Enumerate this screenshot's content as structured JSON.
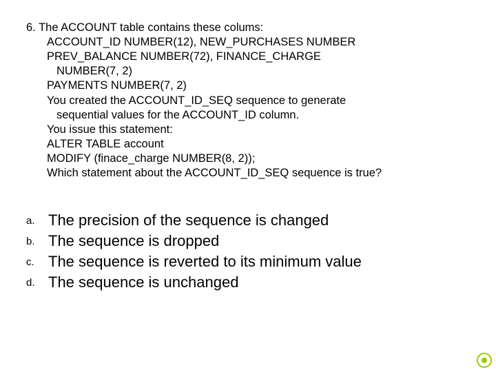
{
  "question": {
    "number": "6.",
    "lead": "The ACCOUNT table contains these colums:",
    "lines": [
      "ACCOUNT_ID NUMBER(12), NEW_PURCHASES NUMBER",
      "PREV_BALANCE NUMBER(72), FINANCE_CHARGE"
    ],
    "sub1": "NUMBER(7, 2)",
    "lines2": [
      "PAYMENTS NUMBER(7, 2)",
      "You created the ACCOUNT_ID_SEQ sequence to generate"
    ],
    "sub2": "sequential values for the ACCOUNT_ID column.",
    "lines3": [
      "You issue this statement:",
      "ALTER TABLE account",
      "MODIFY (finace_charge NUMBER(8, 2));",
      "Which statement about the ACCOUNT_ID_SEQ sequence is true?"
    ]
  },
  "choices": [
    {
      "label": "a.",
      "text": "The precision of the sequence is changed"
    },
    {
      "label": "b.",
      "text": "The sequence is dropped"
    },
    {
      "label": "c.",
      "text": "The sequence is reverted to its minimum value"
    },
    {
      "label": "d.",
      "text": "The sequence is unchanged"
    }
  ]
}
